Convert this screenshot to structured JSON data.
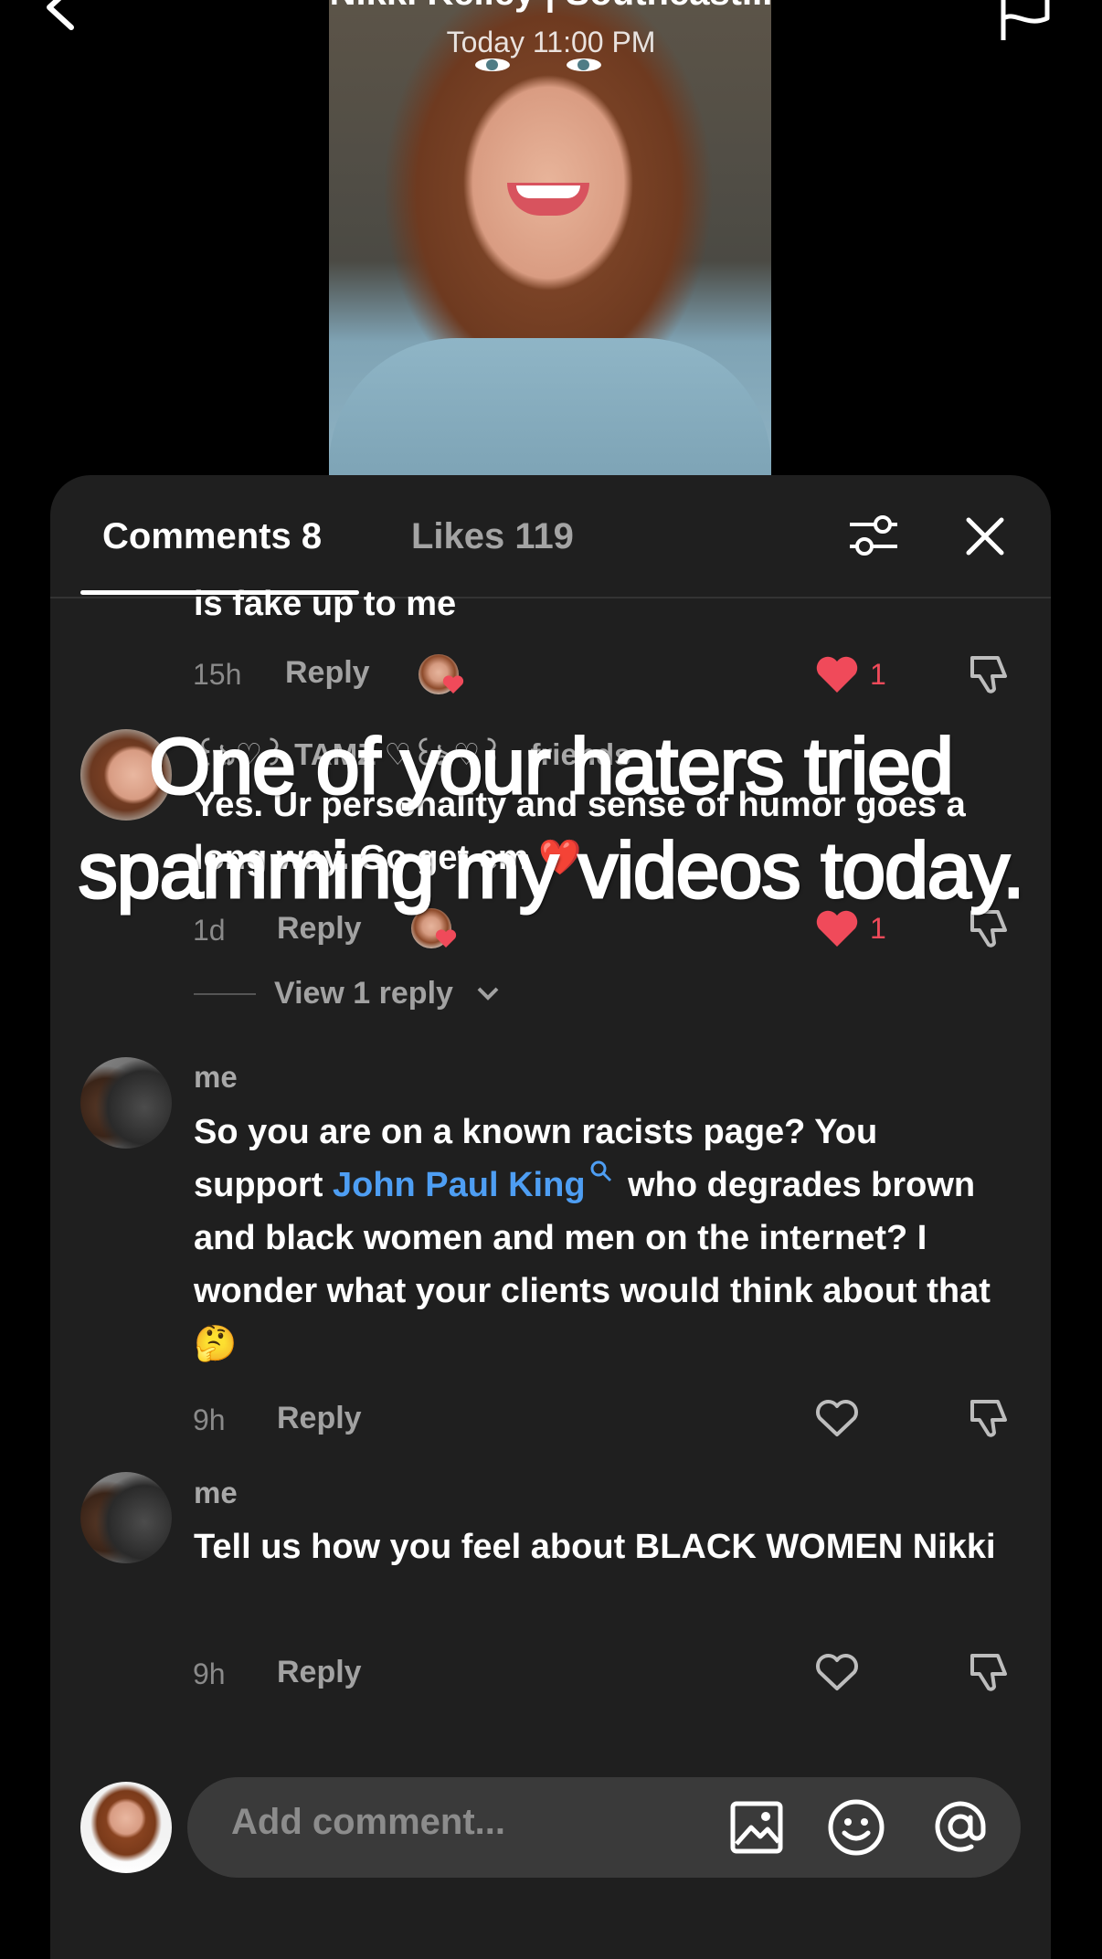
{
  "header": {
    "title": "Nikki Kelley | Southeast...",
    "time": "Today 11:00 PM"
  },
  "tabs": [
    {
      "label": "Comments 8"
    },
    {
      "label": "Likes 119"
    }
  ],
  "overlay_caption": "One of your haters tried spamming my videos today.",
  "comments": [
    {
      "text": "is fake up to me",
      "time": "15h",
      "reply_label": "Reply",
      "likes": "1"
    },
    {
      "username": "꒰ঌ♡꒱ TAMZ ♡꒰ঌ♡꒱ · friends",
      "text": "Yes. Ur personality and sense of humor goes a long way. Go get em ❤️",
      "time": "1d",
      "reply_label": "Reply",
      "likes": "1",
      "view_replies": "View 1 reply"
    },
    {
      "username": "me",
      "text_before": "So you are on a known racists page? You support ",
      "link": "John Paul King",
      "text_after": " who degrades brown and black women and men on the internet? I wonder what your clients would think about that 🤔",
      "time": "9h",
      "reply_label": "Reply"
    },
    {
      "username": "me",
      "text": "Tell us how you feel about BLACK WOMEN Nikki",
      "time": "9h",
      "reply_label": "Reply"
    }
  ],
  "input": {
    "placeholder": "Add comment..."
  },
  "colors": {
    "panel_bg": "#1f1f1f",
    "link": "#4e9ef3",
    "like_red": "#f04a5a"
  }
}
